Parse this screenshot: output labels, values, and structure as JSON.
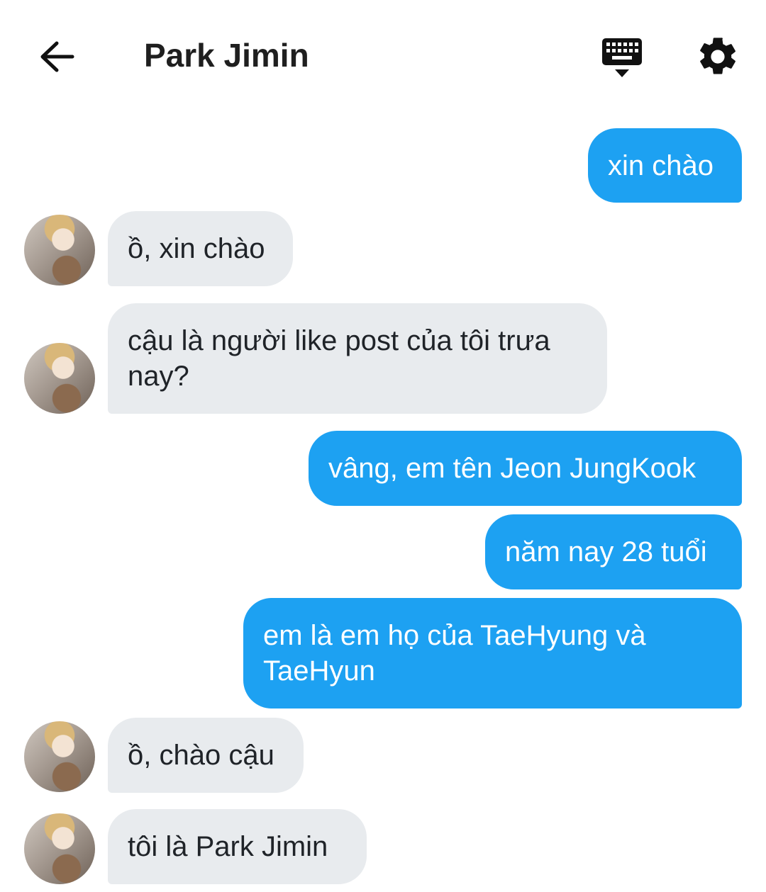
{
  "header": {
    "title": "Park Jimin",
    "back_icon": "arrow-left-icon",
    "keyboard_icon": "keyboard-hide-icon",
    "settings_icon": "gear-icon"
  },
  "colors": {
    "outgoing_bubble": "#1da1f2",
    "incoming_bubble": "#e8ebee",
    "text_dark": "#1f1f1f"
  },
  "messages": [
    {
      "direction": "outgoing",
      "text": "xin chào"
    },
    {
      "direction": "incoming",
      "text": "ồ, xin chào"
    },
    {
      "direction": "incoming",
      "text": "cậu là người like post của tôi trưa nay?"
    },
    {
      "direction": "outgoing",
      "text": "vâng, em tên Jeon JungKook"
    },
    {
      "direction": "outgoing",
      "text": "năm nay 28 tuổi"
    },
    {
      "direction": "outgoing",
      "text": "em là em họ của TaeHyung và TaeHyun"
    },
    {
      "direction": "incoming",
      "text": "ồ, chào cậu"
    },
    {
      "direction": "incoming",
      "text": "tôi là Park Jimin"
    }
  ]
}
